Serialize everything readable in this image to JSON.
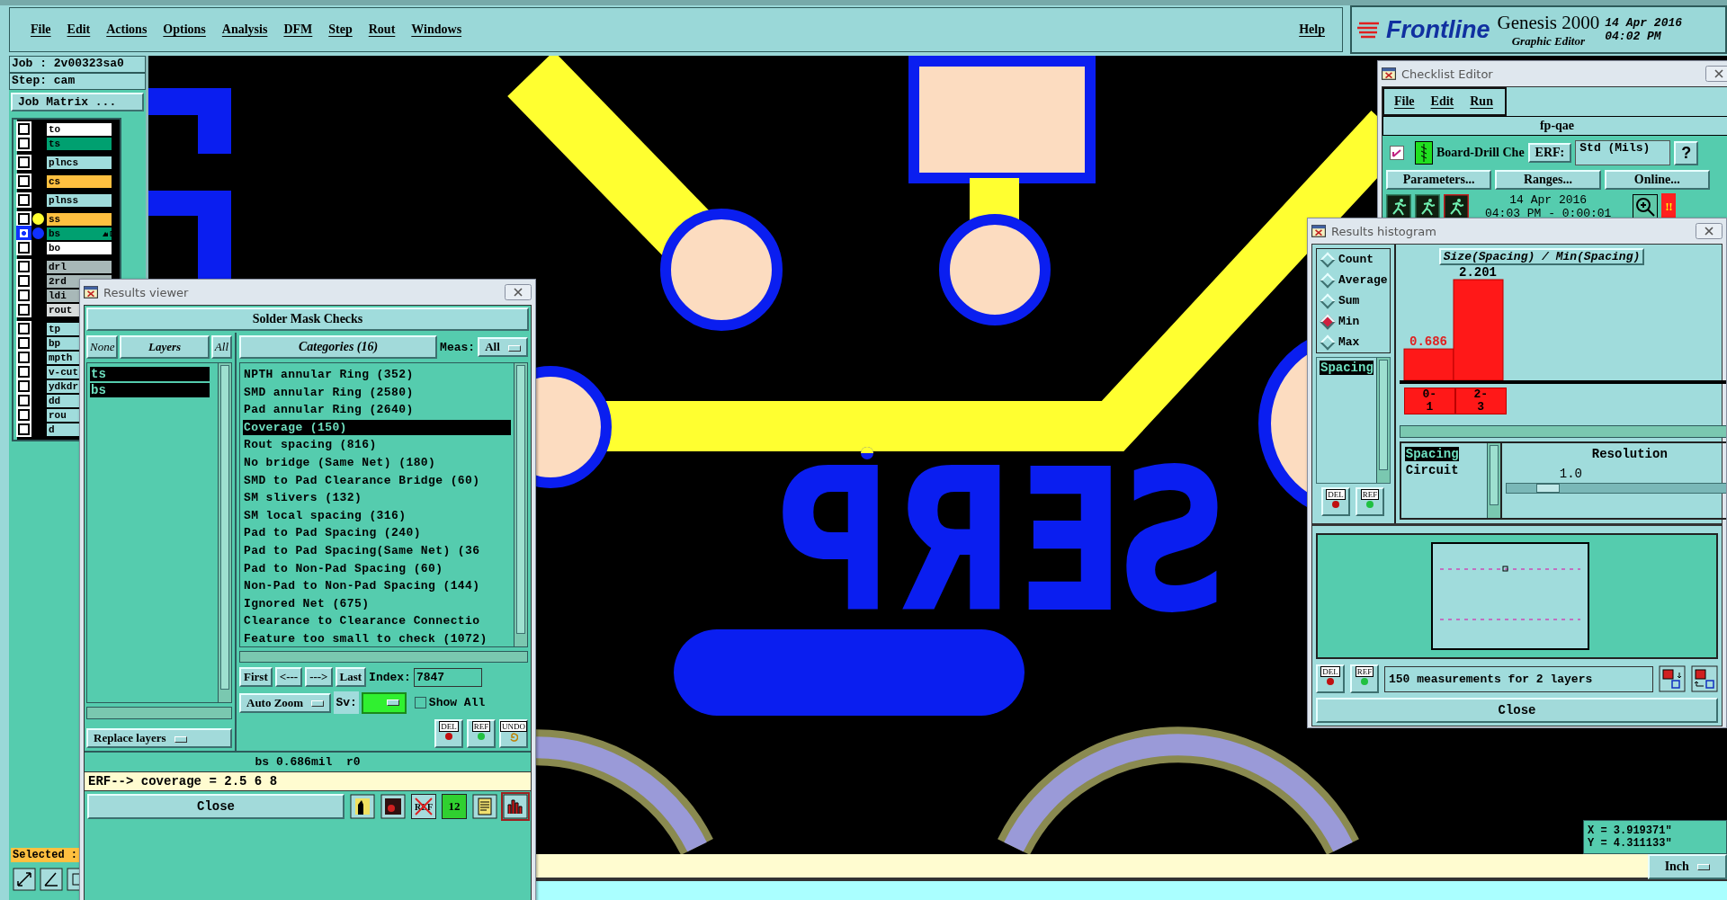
{
  "menu_bar": {
    "items": [
      "File",
      "Edit",
      "Actions",
      "Options",
      "Analysis",
      "DFM",
      "Step",
      "Rout",
      "Windows"
    ],
    "help": "Help"
  },
  "brand": {
    "logo": "Frontline",
    "product": "Genesis 2000",
    "subtitle": "Graphic Editor",
    "date": "14 Apr 2016",
    "time": "04:02 PM"
  },
  "job_panel": {
    "job": "Job : 2v00323sa0",
    "step": "Step: cam",
    "matrix_button": "Job Matrix ...",
    "layer_groups": [
      [
        {
          "name": "to",
          "color": "#ffffff",
          "selected": false
        },
        {
          "name": "ts",
          "color": "#00a070",
          "selected": false
        }
      ],
      [
        {
          "name": "plncs",
          "color": "#a0dcdc",
          "selected": false
        }
      ],
      [
        {
          "name": "cs",
          "color": "#ffc040",
          "selected": false
        }
      ],
      [
        {
          "name": "plnss",
          "color": "#a0dcdc",
          "selected": false
        }
      ],
      [
        {
          "name": "ss",
          "color": "#ffc040",
          "dot": {
            "color": "#ffff30"
          },
          "selected": false
        },
        {
          "name": "bs",
          "color": "#00a070",
          "dot": {
            "color": "#1030ff"
          },
          "selected": true
        },
        {
          "name": "bo",
          "color": "#ffffff",
          "selected": false
        }
      ],
      [
        {
          "name": "drl",
          "color": "#a8b8b8",
          "selected": false
        },
        {
          "name": "2rd",
          "color": "#a8b8b8",
          "selected": false
        },
        {
          "name": "ldi",
          "color": "#a8b8b8",
          "selected": false
        },
        {
          "name": "rout",
          "color": "#d8dcdc",
          "selected": false
        }
      ],
      [
        {
          "name": "tp",
          "color": "#a0dcdc",
          "selected": false
        },
        {
          "name": "bp",
          "color": "#a0dcdc",
          "selected": false
        },
        {
          "name": "mpth",
          "color": "#a0dcdc",
          "selected": false
        },
        {
          "name": "v-cut",
          "color": "#a0dcdc",
          "selected": false
        },
        {
          "name": "ydkdr",
          "color": "#a0dcdc",
          "selected": false
        },
        {
          "name": "dd",
          "color": "#a0dcdc",
          "selected": false
        },
        {
          "name": "rou",
          "color": "#a0dcdc",
          "selected": false
        },
        {
          "name": "d",
          "color": "#a0dcdc",
          "selected": false
        }
      ]
    ],
    "selected_label": "Selected :"
  },
  "canvas": {
    "board_text": "ꟼЯƎƧ",
    "cursor": {
      "x": "X = 3.919371\"",
      "y": "Y = 4.311133\""
    }
  },
  "command_line": {
    "units": "Inch"
  },
  "checklist_editor": {
    "title": "Checklist Editor",
    "menu": [
      "File",
      "Edit",
      "Run"
    ],
    "checklist": "fp-qae",
    "check": {
      "name": "Board-Drill Che",
      "checked": true,
      "erf_button": "ERF:",
      "erf_value": "Std (Mils)",
      "help": "?"
    },
    "buttons": [
      "Parameters...",
      "Ranges...",
      "Online..."
    ],
    "run_date": "14 Apr 2016",
    "run_time": "04:03 PM - 0:00:01",
    "alert": "!!"
  },
  "results_viewer": {
    "title": "Results viewer",
    "heading": "Solder Mask Checks",
    "layer_buttons": [
      "None",
      "Layers",
      "All"
    ],
    "layers": [
      {
        "name": "ts",
        "selected": true
      },
      {
        "name": "bs",
        "selected": true
      }
    ],
    "categories_button": "Categories (16)",
    "meas_label": "Meas:",
    "meas_value": "All",
    "categories": [
      {
        "label": "NPTH annular Ring (352)",
        "selected": false
      },
      {
        "label": "SMD annular Ring (2580)",
        "selected": false
      },
      {
        "label": "Pad annular Ring (2640)",
        "selected": false
      },
      {
        "label": "Coverage (150)",
        "selected": true
      },
      {
        "label": "Rout spacing (816)",
        "selected": false
      },
      {
        "label": "No bridge (Same Net) (180)",
        "selected": false
      },
      {
        "label": "SMD to Pad Clearance Bridge (60)",
        "selected": false
      },
      {
        "label": "SM slivers (132)",
        "selected": false
      },
      {
        "label": "SM local spacing (316)",
        "selected": false
      },
      {
        "label": "Pad to Pad Spacing (240)",
        "selected": false
      },
      {
        "label": "Pad to Pad Spacing(Same Net) (36",
        "selected": false
      },
      {
        "label": "Pad to Non-Pad Spacing (60)",
        "selected": false
      },
      {
        "label": "Non-Pad to Non-Pad Spacing (144)",
        "selected": false
      },
      {
        "label": "Ignored Net (675)",
        "selected": false
      },
      {
        "label": "Clearance to Clearance Connectio",
        "selected": false
      },
      {
        "label": "Feature too small to check (1072)",
        "selected": false
      }
    ],
    "nav_buttons": [
      "First",
      "<---",
      "--->",
      "Last"
    ],
    "index_label": "Index:",
    "index_value": "7847",
    "zoom_mode": "Auto Zoom",
    "sv_label": "Sv:",
    "show_all": {
      "label": "Show All",
      "checked": false
    },
    "actions": [
      "DEL",
      "REF",
      "UNDO"
    ],
    "replace_mode": "Replace layers",
    "status": "bs 0.686mil  r0",
    "erf_line": "ERF--> coverage = 2.5 6 8",
    "close": "Close",
    "toolbar": [
      {
        "kind": "figure",
        "selected": false
      },
      {
        "kind": "stop",
        "selected": false
      },
      {
        "kind": "ref-off",
        "label": "REF",
        "selected": false
      },
      {
        "kind": "numbers",
        "label": "12",
        "selected": false
      },
      {
        "kind": "notes",
        "selected": false
      },
      {
        "kind": "chart",
        "selected": true
      }
    ]
  },
  "histogram": {
    "title": "Results histogram",
    "modes": [
      {
        "label": "Count",
        "selected": false
      },
      {
        "label": "Average",
        "selected": false
      },
      {
        "label": "Sum",
        "selected": false
      },
      {
        "label": "Min",
        "selected": true
      },
      {
        "label": "Max",
        "selected": false
      }
    ],
    "measures": [
      {
        "label": "Spacing",
        "selected": true
      }
    ],
    "chart_data": {
      "type": "bar",
      "title": "Size(Spacing) / Min(Spacing)",
      "categories": [
        "0-1",
        "2-3"
      ],
      "values": [
        0.686,
        2.201
      ],
      "data_labels": true
    },
    "groups": [
      {
        "label": "Spacing",
        "selected": true
      },
      {
        "label": "Circuit",
        "selected": false
      }
    ],
    "resolution": {
      "label": "Resolution",
      "value": "1.0",
      "level": 0.12
    },
    "list_actions": [
      "DEL",
      "REF"
    ],
    "actions": [
      "DEL",
      "REF"
    ],
    "summary": "150 measurements for 2 layers",
    "close": "Close"
  }
}
